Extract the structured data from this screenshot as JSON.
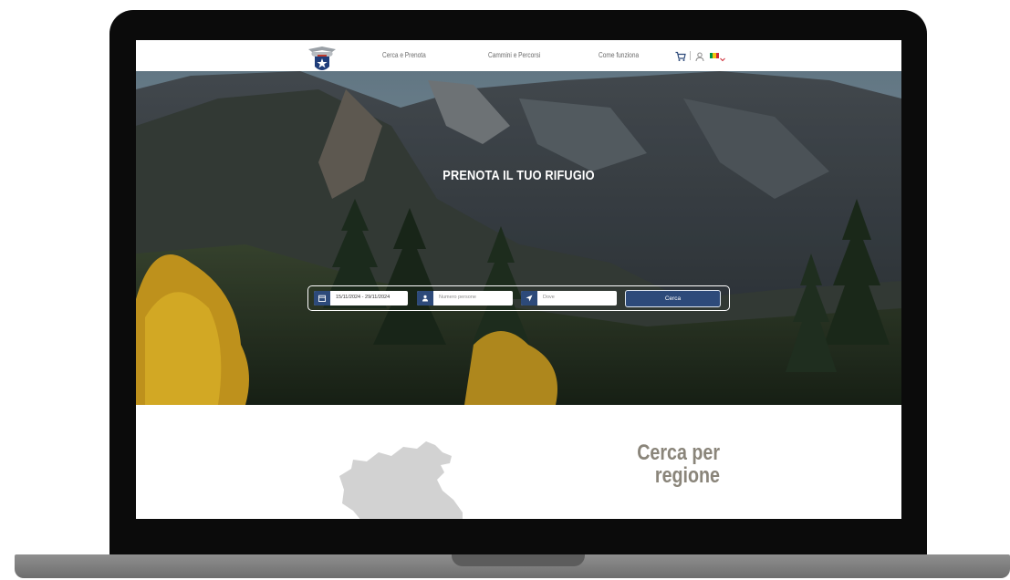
{
  "navbar": {
    "links": [
      "Cerca e Prenota",
      "Cammini e Percorsi",
      "Come funziona"
    ],
    "cart_icon": "cart-icon",
    "user_icon": "user-icon",
    "language_flag": "italy-flag-icon",
    "language_colors": [
      "#009246",
      "#f1c40f",
      "#ce2b37"
    ]
  },
  "hero": {
    "title": "PRENOTA IL TUO RIFUGIO"
  },
  "search": {
    "dates_value": "15/11/2024 - 29/11/2024",
    "people_placeholder": "Numero persone",
    "where_placeholder": "Dove",
    "button_label": "Cerca",
    "accent_color": "#2d4a7a"
  },
  "region": {
    "title_line1": "Cerca per",
    "title_line2": "regione"
  }
}
